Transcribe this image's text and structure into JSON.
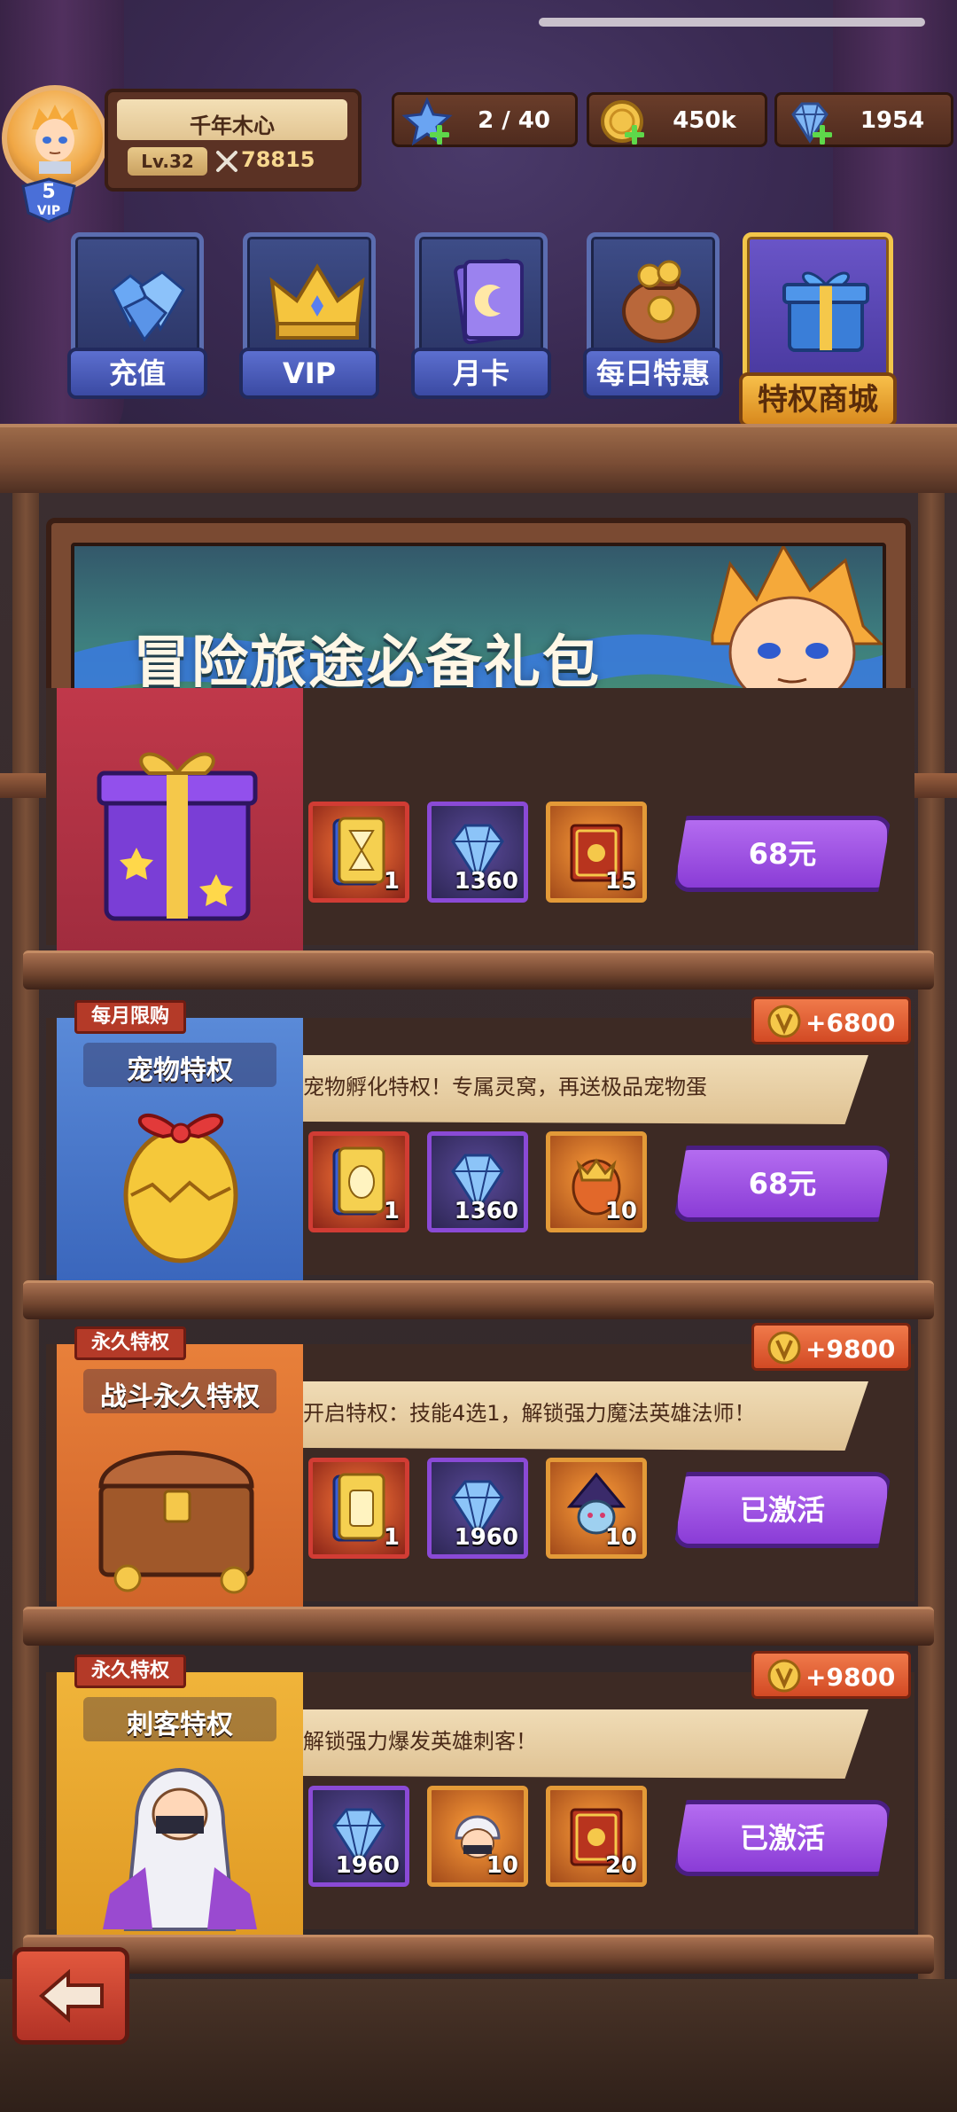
{
  "player": {
    "name": "千年木心",
    "level": "Lv.32",
    "power": "78815",
    "vip_level": "5",
    "vip_label": "VIP"
  },
  "resources": {
    "stamina": "2 / 40",
    "gold": "450k",
    "gems": "1954"
  },
  "tabs": [
    {
      "label": "充值",
      "icon": "gems-pile-icon"
    },
    {
      "label": "VIP",
      "icon": "crown-icon"
    },
    {
      "label": "月卡",
      "icon": "moon-card-icon"
    },
    {
      "label": "每日特惠",
      "icon": "coin-bag-icon"
    },
    {
      "label": "特权商城",
      "icon": "gift-chest-icon",
      "active": true
    }
  ],
  "banner": {
    "title": "冒险旅途必备礼包"
  },
  "packages": [
    {
      "items": [
        {
          "icon": "hourglass-card-icon",
          "qty": "1",
          "rarity": "red"
        },
        {
          "icon": "gem-icon",
          "qty": "1360",
          "rarity": "purple"
        },
        {
          "icon": "treasure-book-icon",
          "qty": "15",
          "rarity": "orange"
        }
      ],
      "button": "68元"
    },
    {
      "tag": "每月限购",
      "title": "宠物特权",
      "bonus": "+6800",
      "desc": "宠物孵化特权！专属灵窝，再送极品宠物蛋",
      "items": [
        {
          "icon": "pet-card-icon",
          "qty": "1",
          "rarity": "red"
        },
        {
          "icon": "gem-icon",
          "qty": "1360",
          "rarity": "purple"
        },
        {
          "icon": "pet-egg-icon",
          "qty": "10",
          "rarity": "orange"
        }
      ],
      "button": "68元"
    },
    {
      "tag": "永久特权",
      "title": "战斗永久特权",
      "bonus": "+9800",
      "desc": "开启特权：技能4选1，解锁强力魔法英雄法师！",
      "items": [
        {
          "icon": "skill-card-icon",
          "qty": "1",
          "rarity": "red"
        },
        {
          "icon": "gem-icon",
          "qty": "1960",
          "rarity": "purple"
        },
        {
          "icon": "mage-hero-icon",
          "qty": "10",
          "rarity": "orange"
        }
      ],
      "button": "已激活"
    },
    {
      "tag": "永久特权",
      "title": "刺客特权",
      "bonus": "+9800",
      "desc": "解锁强力爆发英雄刺客！",
      "items": [
        {
          "icon": "gem-icon",
          "qty": "1960",
          "rarity": "purple"
        },
        {
          "icon": "assassin-hero-icon",
          "qty": "10",
          "rarity": "orange"
        },
        {
          "icon": "treasure-book-icon",
          "qty": "20",
          "rarity": "orange"
        }
      ],
      "button": "已激活"
    }
  ],
  "colors": {
    "buy_button": "#8a3cd6",
    "active_tab": "#f2c64a",
    "bonus_tag": "#d24a24"
  }
}
